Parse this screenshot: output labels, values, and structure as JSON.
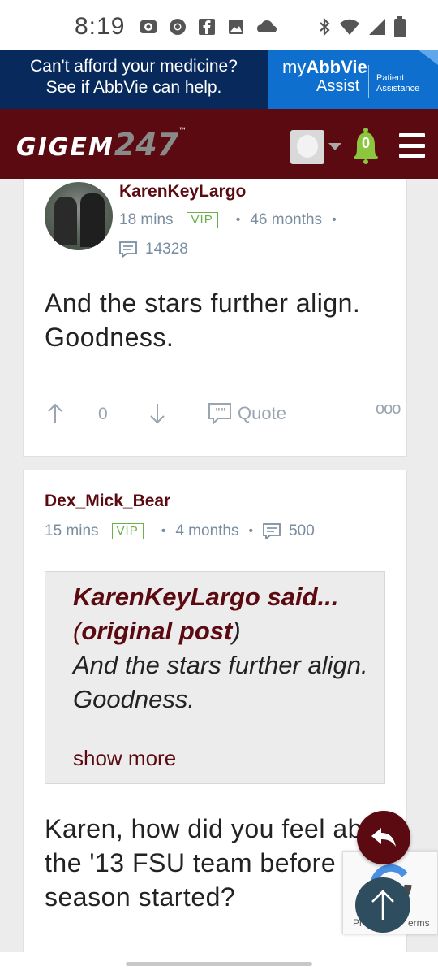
{
  "status_bar": {
    "time": "8:19",
    "left_icons": [
      "record-icon",
      "chrome-icon",
      "facebook-icon",
      "image-icon",
      "cloud-icon"
    ],
    "right_icons": [
      "bluetooth-icon",
      "wifi-icon",
      "signal-icon",
      "battery-icon"
    ]
  },
  "ad": {
    "line1": "Can't afford your medicine?",
    "line2": "See if AbbVie can help.",
    "brand_prefix": "my",
    "brand_name": "AbbVie",
    "brand_suffix": "Assist",
    "tagline_1": "Patient",
    "tagline_2": "Assistance"
  },
  "header": {
    "logo_text": "GIGEM",
    "logo_num": "247",
    "logo_tm": "™",
    "notification_count": "0",
    "colors": {
      "maroon": "#5a0a10",
      "bell_green": "#8cc63f"
    }
  },
  "posts": [
    {
      "username": "KarenKeyLargo",
      "time": "18 mins",
      "badge": "VIP",
      "member_for": "46 months",
      "post_count": "14328",
      "body": "And the stars further align. Goodness.",
      "upvotes": "0",
      "quote_label": "Quote",
      "more_label": "ooo"
    },
    {
      "username": "Dex_Mick_Bear",
      "time": "15 mins",
      "badge": "VIP",
      "member_for": "4 months",
      "post_count": "500",
      "quote": {
        "author": "KarenKeyLargo",
        "said": "said...",
        "open_paren": "(",
        "link": "original post",
        "close_paren": ")",
        "text": "And the stars further align. Goodness.",
        "show_more": "show more"
      },
      "body": "Karen, how did you feel about the '13 FSU team before the season started?"
    }
  ],
  "recaptcha": {
    "text_left": "Pr",
    "text_right": "erms"
  }
}
